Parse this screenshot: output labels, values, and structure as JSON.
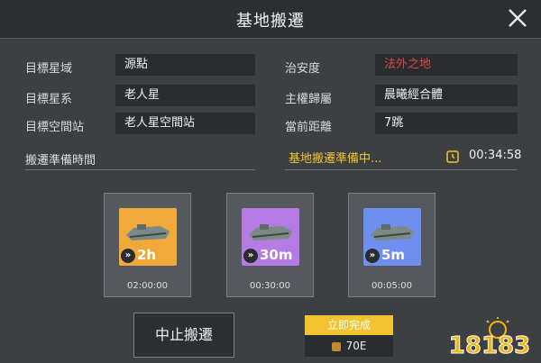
{
  "header": {
    "title": "基地搬遷"
  },
  "info": {
    "left": [
      {
        "label": "目標星域",
        "value": "源點"
      },
      {
        "label": "目標星系",
        "value": "老人星"
      },
      {
        "label": "目標空間站",
        "value": "老人星空間站"
      }
    ],
    "right": [
      {
        "label": "治安度",
        "value": "法外之地"
      },
      {
        "label": "主權歸屬",
        "value": "晨曦經合體"
      },
      {
        "label": "當前距離",
        "value": "7跳"
      }
    ]
  },
  "prep": {
    "label": "搬遷準備時間",
    "status": "基地搬遷準備中...",
    "timer": "00:34:58"
  },
  "options": [
    {
      "duration": "2h",
      "time": "02:00:00",
      "color": "#f1a93a"
    },
    {
      "duration": "30m",
      "time": "00:30:00",
      "color": "#b37be3"
    },
    {
      "duration": "5m",
      "time": "00:05:00",
      "color": "#6f8ff0"
    }
  ],
  "actions": {
    "stop_label": "中止搬遷",
    "complete_label": "立即完成",
    "cost": "70E"
  },
  "watermark": {
    "text": "18183"
  }
}
